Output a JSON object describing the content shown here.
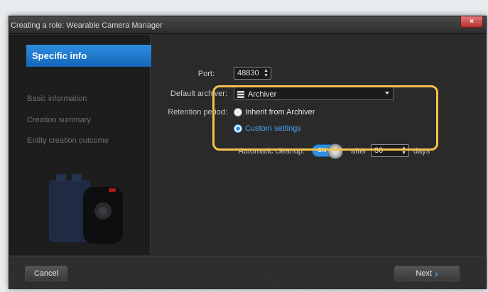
{
  "window": {
    "title": "Creating a role: Wearable Camera Manager",
    "close_glyph": "×"
  },
  "sidebar": {
    "items": [
      {
        "label": "Specific info",
        "active": true
      },
      {
        "label": "Basic information",
        "active": false
      },
      {
        "label": "Creation summary",
        "active": false
      },
      {
        "label": "Entity creation outcome",
        "active": false
      }
    ]
  },
  "form": {
    "port_label": "Port:",
    "port_value": "48830",
    "archiver_label": "Default archiver:",
    "archiver_value": "Archiver",
    "retention_label": "Retention period:",
    "retention_option_inherit": "Inherit from Archiver",
    "retention_option_custom": "Custom settings",
    "retention_selected": "Custom settings",
    "cleanup_label": "Automatic cleanup:",
    "cleanup_toggle": "ON",
    "after_label": "after",
    "days_value": "30",
    "days_label": "days"
  },
  "footer": {
    "cancel_label": "Cancel",
    "next_label": "Next",
    "next_icon": "›"
  },
  "colors": {
    "accent": "#2d8de0",
    "highlight": "#f4c24c",
    "background": "#2a2a2a"
  }
}
